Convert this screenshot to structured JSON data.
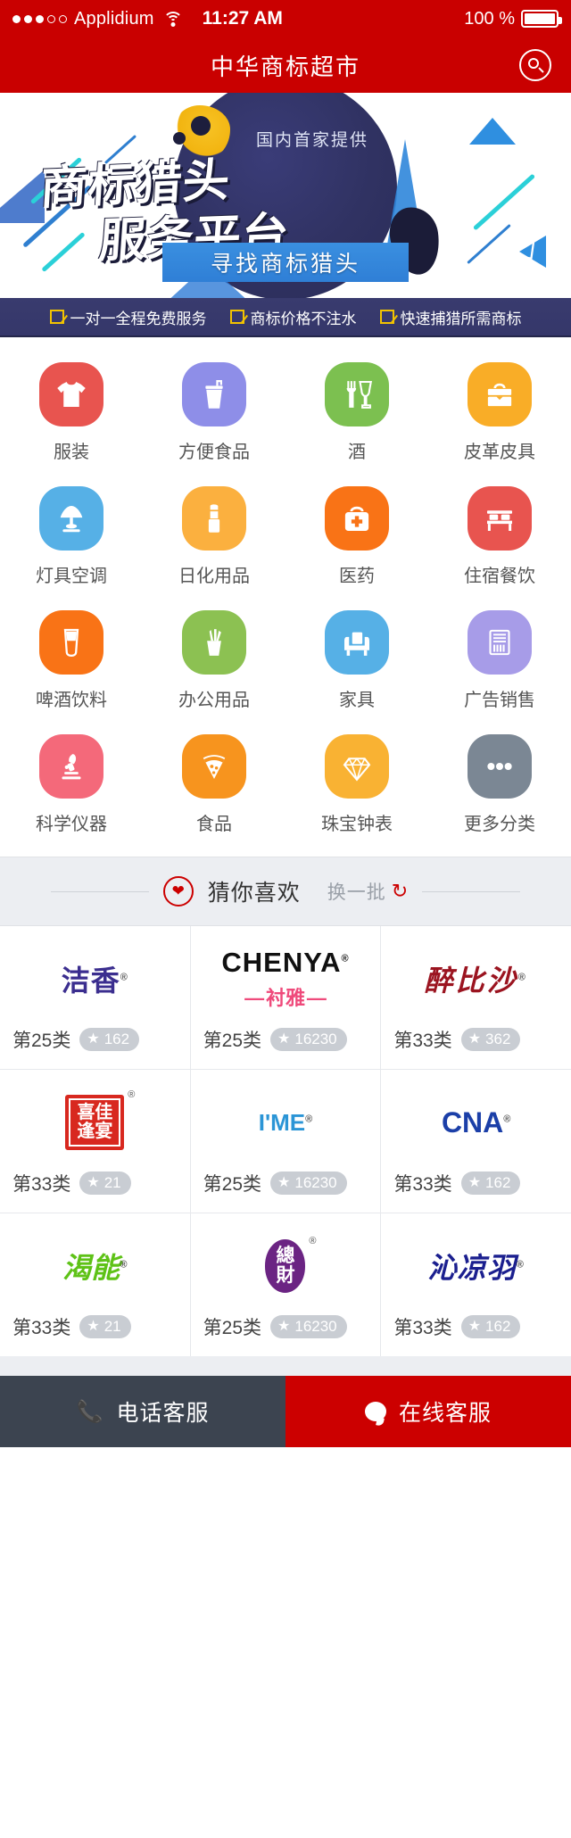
{
  "status_bar": {
    "signal_filled": 3,
    "signal_empty": 2,
    "carrier": "Applidium",
    "wifi_icon": "wifi-icon",
    "time": "11:27 AM",
    "battery_percent": "100 %"
  },
  "app_bar": {
    "title": "中华商标超市",
    "search_icon": "search-icon"
  },
  "banner": {
    "kicker": "国内首家提供",
    "headline_line1": "商标猎头",
    "headline_line2": "服务平台",
    "quote_open": "「",
    "quote_close": "」",
    "cta_label": "寻找商标猎头"
  },
  "features": [
    {
      "label": "一对一全程免费服务",
      "icon": "check-box-icon"
    },
    {
      "label": "商标价格不注水",
      "icon": "check-box-icon"
    },
    {
      "label": "快速捕猎所需商标",
      "icon": "check-box-icon"
    }
  ],
  "categories": [
    {
      "label": "服装",
      "icon": "tshirt-icon",
      "color": "#e8544f"
    },
    {
      "label": "方便食品",
      "icon": "drink-cup-icon",
      "color": "#8e8ee8"
    },
    {
      "label": "酒",
      "icon": "fork-wine-icon",
      "color": "#7cc050"
    },
    {
      "label": "皮革皮具",
      "icon": "briefcase-icon",
      "color": "#f9ad27"
    },
    {
      "label": "灯具空调",
      "icon": "desk-lamp-icon",
      "color": "#56b0e6"
    },
    {
      "label": "日化用品",
      "icon": "lipstick-icon",
      "color": "#fbb03f"
    },
    {
      "label": "医药",
      "icon": "medical-kit-icon",
      "color": "#f97316"
    },
    {
      "label": "住宿餐饮",
      "icon": "bed-icon",
      "color": "#e8544f"
    },
    {
      "label": "啤酒饮料",
      "icon": "beer-glass-icon",
      "color": "#f97316"
    },
    {
      "label": "办公用品",
      "icon": "pen-cup-icon",
      "color": "#8cc152"
    },
    {
      "label": "家具",
      "icon": "armchair-icon",
      "color": "#56b0e6"
    },
    {
      "label": "广告销售",
      "icon": "newspaper-icon",
      "color": "#a79ce8"
    },
    {
      "label": "科学仪器",
      "icon": "microscope-icon",
      "color": "#f4697a"
    },
    {
      "label": "食品",
      "icon": "pizza-icon",
      "color": "#f7941e"
    },
    {
      "label": "珠宝钟表",
      "icon": "diamond-icon",
      "color": "#f9b233"
    },
    {
      "label": "更多分类",
      "icon": "ellipsis-icon",
      "color": "#7b8794"
    }
  ],
  "recommend": {
    "heart_icon": "heart-icon",
    "title": "猜你喜欢",
    "refresh_label": "换一批",
    "refresh_icon": "refresh-icon"
  },
  "products": [
    {
      "logo_text": "洁香",
      "logo_style": "script-purple",
      "logo_color": "#3b2e8f",
      "class_label": "第25类",
      "star_icon": "star-icon",
      "count": "162"
    },
    {
      "logo_text": "CHENYA",
      "logo_sub": "衬雅",
      "logo_style": "latin-black",
      "logo_color": "#111111",
      "sub_color": "#ef4a7b",
      "class_label": "第25类",
      "star_icon": "star-icon",
      "count": "16230"
    },
    {
      "logo_text": "醉比沙",
      "logo_style": "brush-red",
      "logo_color": "#9b1420",
      "class_label": "第33类",
      "star_icon": "star-icon",
      "count": "362"
    },
    {
      "logo_text": "喜佳逢宴",
      "logo_style": "seal-red",
      "logo_color": "#d8281f",
      "class_label": "第33类",
      "star_icon": "star-icon",
      "count": "21"
    },
    {
      "logo_text": "I'ME",
      "logo_style": "latin-blue",
      "logo_color": "#2b95d6",
      "class_label": "第25类",
      "star_icon": "star-icon",
      "count": "16230"
    },
    {
      "logo_text": "CNA",
      "logo_style": "latin-navy",
      "logo_color": "#1b3fa8",
      "class_label": "第33类",
      "star_icon": "star-icon",
      "count": "162"
    },
    {
      "logo_text": "渴能",
      "logo_style": "outline-green",
      "logo_color": "#5ec217",
      "class_label": "第33类",
      "star_icon": "star-icon",
      "count": "21"
    },
    {
      "logo_text": "總財",
      "logo_style": "pill-purple",
      "logo_color": "#6b2483",
      "class_label": "第25类",
      "star_icon": "star-icon",
      "count": "16230"
    },
    {
      "logo_text": "沁凉羽",
      "logo_style": "bold-navy",
      "logo_color": "#1b1f8f",
      "class_label": "第33类",
      "star_icon": "star-icon",
      "count": "162"
    }
  ],
  "footer": [
    {
      "label": "电话客服",
      "icon": "phone-icon",
      "style": "dark"
    },
    {
      "label": "在线客服",
      "icon": "chat-bubble-icon",
      "style": "red"
    }
  ],
  "colors": {
    "brand_red": "#c90000",
    "footer_dark": "#3c4450",
    "banner_navy": "#2a2c58",
    "cta_blue": "#2f7fd6",
    "badge_gray": "#c9cdd3"
  }
}
